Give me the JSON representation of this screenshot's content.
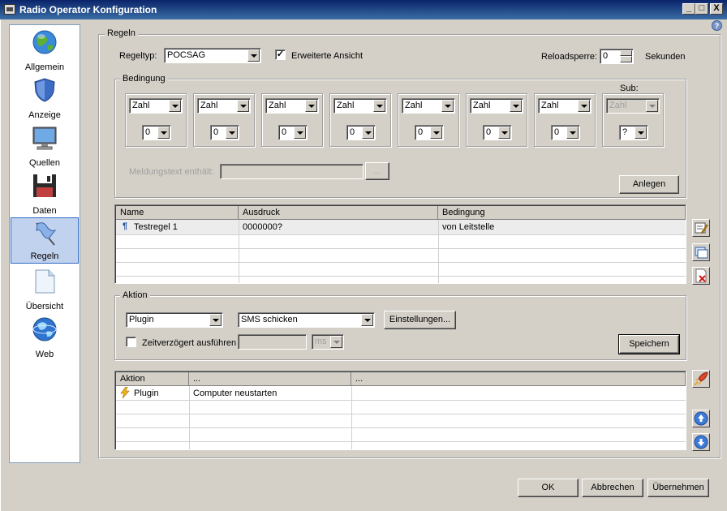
{
  "window": {
    "title": "Radio Operator Konfiguration",
    "minimize": "_",
    "maximize": "□",
    "close": "X",
    "help": "?"
  },
  "sidebar": {
    "items": [
      {
        "label": "Allgemein",
        "icon": "globe-icon"
      },
      {
        "label": "Anzeige",
        "icon": "shield-icon"
      },
      {
        "label": "Quellen",
        "icon": "monitor-icon"
      },
      {
        "label": "Daten",
        "icon": "floppy-disk-icon"
      },
      {
        "label": "Regeln",
        "icon": "flag-icon",
        "selected": true
      },
      {
        "label": "Übersicht",
        "icon": "document-icon"
      },
      {
        "label": "Web",
        "icon": "web-globe-icon"
      }
    ]
  },
  "regeln": {
    "group_label": "Regeln",
    "regeltyp_label": "Regeltyp:",
    "regeltyp_value": "POCSAG",
    "erweitert_label": "Erweiterte Ansicht",
    "erweitert_checked": "✓",
    "reload_label": "Reloadsperre:",
    "reload_value": "0",
    "reload_unit": "Sekunden"
  },
  "bedingung": {
    "group_label": "Bedingung",
    "sub_label": "Sub:",
    "columns": [
      {
        "type": "Zahl",
        "value": "0"
      },
      {
        "type": "Zahl",
        "value": "0"
      },
      {
        "type": "Zahl",
        "value": "0"
      },
      {
        "type": "Zahl",
        "value": "0"
      },
      {
        "type": "Zahl",
        "value": "0"
      },
      {
        "type": "Zahl",
        "value": "0"
      },
      {
        "type": "Zahl",
        "value": "0"
      },
      {
        "type": "Zahl",
        "value": "?"
      }
    ],
    "meldungstext_label": "Meldungstext enthält:",
    "browse_label": "...",
    "anlegen_label": "Anlegen"
  },
  "rules_table": {
    "headers": [
      "Name",
      "Ausdruck",
      "Bedingung"
    ],
    "rows": [
      {
        "name": "Testregel 1",
        "ausdruck": "0000000?",
        "bedingung": "von Leitstelle"
      }
    ]
  },
  "aktion": {
    "group_label": "Aktion",
    "type_value": "Plugin",
    "action_value": "SMS schicken",
    "settings_label": "Einstellungen...",
    "delay_label": "Zeitverzögert ausführen",
    "delay_unit": "ms",
    "save_label": "Speichern"
  },
  "actions_table": {
    "headers": [
      "Aktion",
      "...",
      "..."
    ],
    "rows": [
      {
        "aktion": "Plugin",
        "detail": "Computer neustarten",
        "extra": ""
      }
    ]
  },
  "footer": {
    "ok": "OK",
    "cancel": "Abbrechen",
    "apply": "Übernehmen"
  }
}
